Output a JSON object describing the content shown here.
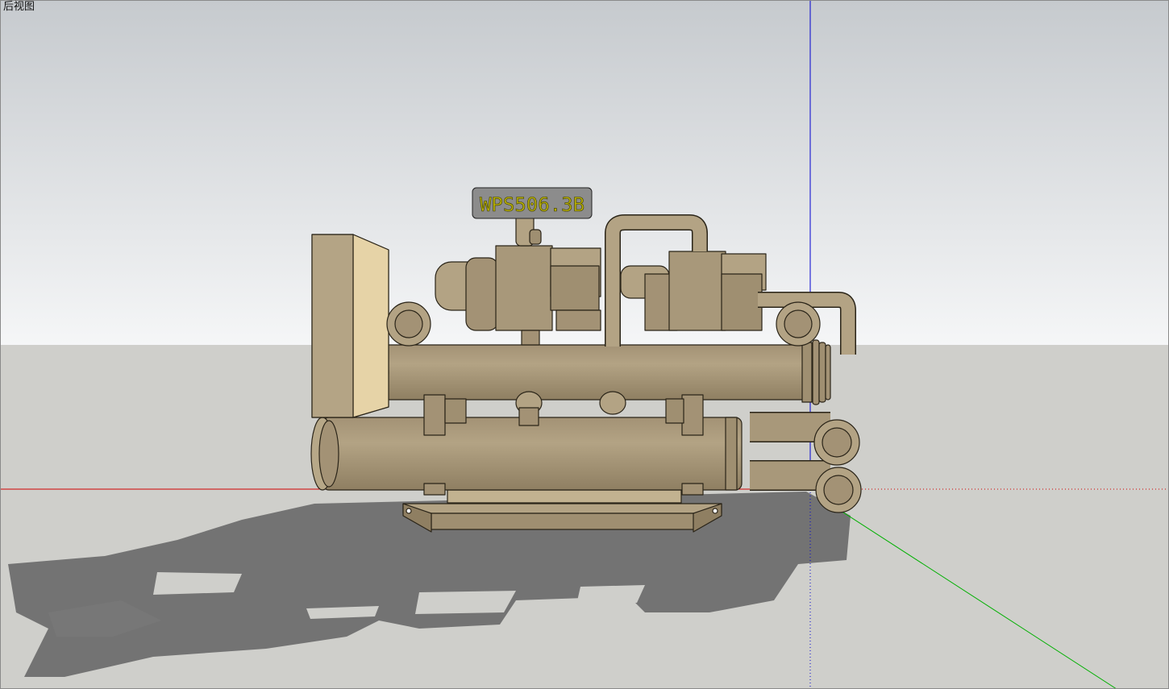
{
  "view": {
    "label": "后视图"
  },
  "model": {
    "tag_text": "WPS506.3B",
    "components": [
      "control-cabinet",
      "screw-compressor-left",
      "screw-compressor-right",
      "condenser-shell",
      "evaporator-shell",
      "water-flanges",
      "base-frame"
    ]
  },
  "colors": {
    "sky_top": "#c8ccd0",
    "sky_bottom": "#f4f5f6",
    "ground": "#cfcfcb",
    "shadow": "#737373",
    "machine_body": "#a8987a",
    "machine_light": "#d8c49a",
    "machine_outline": "#2a2418",
    "axis_red": "#d00000",
    "axis_green": "#00b000",
    "axis_blue": "#0000d0",
    "tag_fill": "#8c8c8c"
  },
  "icons": {
    "axis_red": "red-axis-line",
    "axis_green": "green-axis-line",
    "axis_blue": "blue-axis-line"
  }
}
